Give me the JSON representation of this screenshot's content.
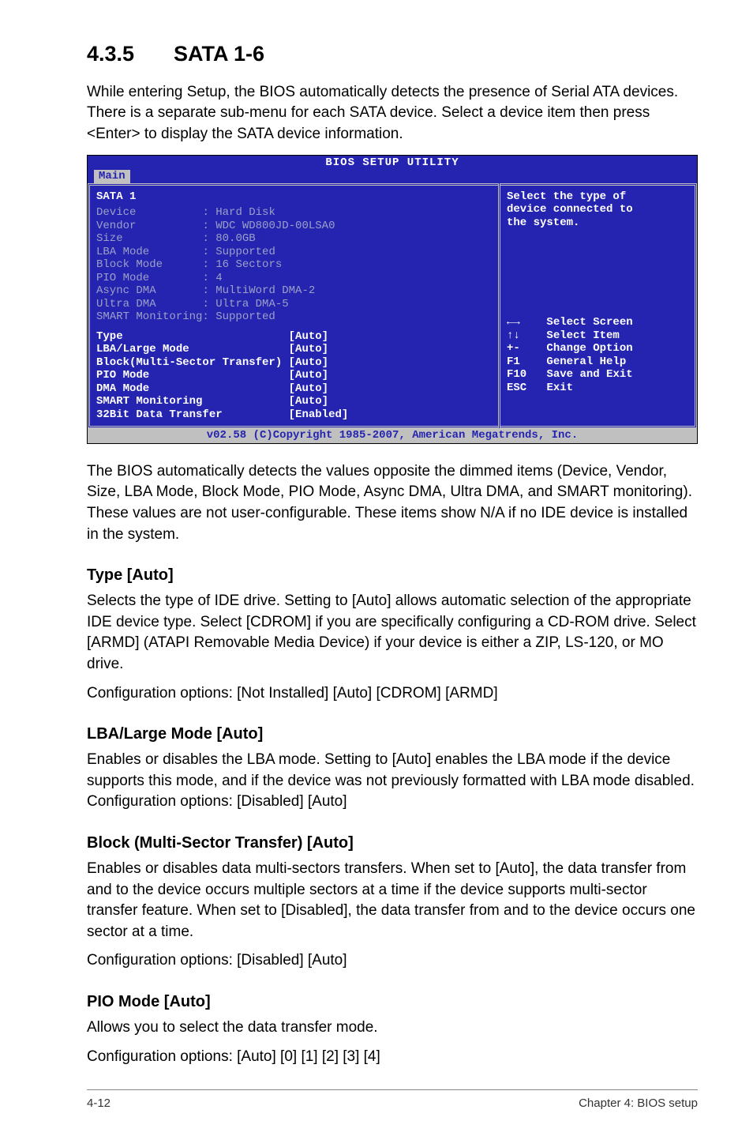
{
  "section_number": "4.3.5",
  "section_title": "SATA 1-6",
  "intro": "While entering Setup, the BIOS automatically detects the presence of Serial ATA devices. There is a separate sub-menu for each SATA device. Select a device item then press <Enter> to display the SATA device information.",
  "bios": {
    "title": "BIOS SETUP UTILITY",
    "tab": "Main",
    "heading": "SATA 1",
    "detected": [
      {
        "k": "Device",
        "v": ": Hard Disk"
      },
      {
        "k": "Vendor",
        "v": ": WDC WD800JD-00LSA0"
      },
      {
        "k": "Size",
        "v": ": 80.0GB"
      },
      {
        "k": "LBA Mode",
        "v": ": Supported"
      },
      {
        "k": "Block Mode",
        "v": ": 16 Sectors"
      },
      {
        "k": "PIO Mode",
        "v": ": 4"
      },
      {
        "k": "Async DMA",
        "v": ": MultiWord DMA-2"
      },
      {
        "k": "Ultra DMA",
        "v": ": Ultra DMA-5"
      },
      {
        "k": "SMART Monitoring",
        "v": ": Supported"
      }
    ],
    "options": [
      {
        "name": "Type",
        "val": "[Auto]"
      },
      {
        "name": "LBA/Large Mode",
        "val": "[Auto]"
      },
      {
        "name": "Block(Multi-Sector Transfer)",
        "val": "[Auto]"
      },
      {
        "name": "PIO Mode",
        "val": "[Auto]"
      },
      {
        "name": "DMA Mode",
        "val": "[Auto]"
      },
      {
        "name": "SMART Monitoring",
        "val": "[Auto]"
      },
      {
        "name": "32Bit Data Transfer",
        "val": "[Enabled]"
      }
    ],
    "help_top1": "Select the type of",
    "help_top2": "device connected to",
    "help_top3": "the system.",
    "hints": [
      {
        "k": "←→",
        "v": "Select Screen"
      },
      {
        "k": "↑↓",
        "v": "Select Item"
      },
      {
        "k": "+-",
        "v": "Change Option"
      },
      {
        "k": "F1",
        "v": "General Help"
      },
      {
        "k": "F10",
        "v": "Save and Exit"
      },
      {
        "k": "ESC",
        "v": "Exit"
      }
    ],
    "copyright": "v02.58 (C)Copyright 1985-2007, American Megatrends, Inc."
  },
  "para_after_bios": "The BIOS automatically detects the values opposite the dimmed items (Device, Vendor, Size, LBA Mode, Block Mode, PIO Mode, Async DMA, Ultra DMA, and SMART monitoring). These values are not user-configurable. These items show N/A if no IDE device is installed in the system.",
  "sections": [
    {
      "h": "Type [Auto]",
      "p": [
        "Selects the type of IDE drive. Setting to [Auto] allows automatic selection of the appropriate IDE device type. Select [CDROM] if you are specifically configuring a CD-ROM drive. Select [ARMD] (ATAPI Removable Media Device) if your device is either a ZIP, LS-120, or MO drive.",
        "Configuration options: [Not Installed] [Auto] [CDROM] [ARMD]"
      ]
    },
    {
      "h": "LBA/Large Mode [Auto]",
      "p": [
        "Enables or disables the LBA mode. Setting to [Auto] enables the LBA mode if the device supports this mode, and if the device was not previously formatted with LBA mode disabled. Configuration options: [Disabled] [Auto]"
      ]
    },
    {
      "h": "Block (Multi-Sector Transfer) [Auto]",
      "p": [
        "Enables or disables data multi-sectors transfers. When set to [Auto], the data transfer from and to the device occurs multiple sectors at a time if the device supports multi-sector transfer feature. When set to [Disabled], the data transfer from and to the device occurs one sector at a time.",
        "Configuration options: [Disabled] [Auto]"
      ]
    },
    {
      "h": "PIO Mode [Auto]",
      "p": [
        "Allows you to select the data transfer mode.",
        "Configuration options: [Auto] [0] [1] [2] [3] [4]"
      ]
    }
  ],
  "footer_left": "4-12",
  "footer_right": "Chapter 4: BIOS setup"
}
